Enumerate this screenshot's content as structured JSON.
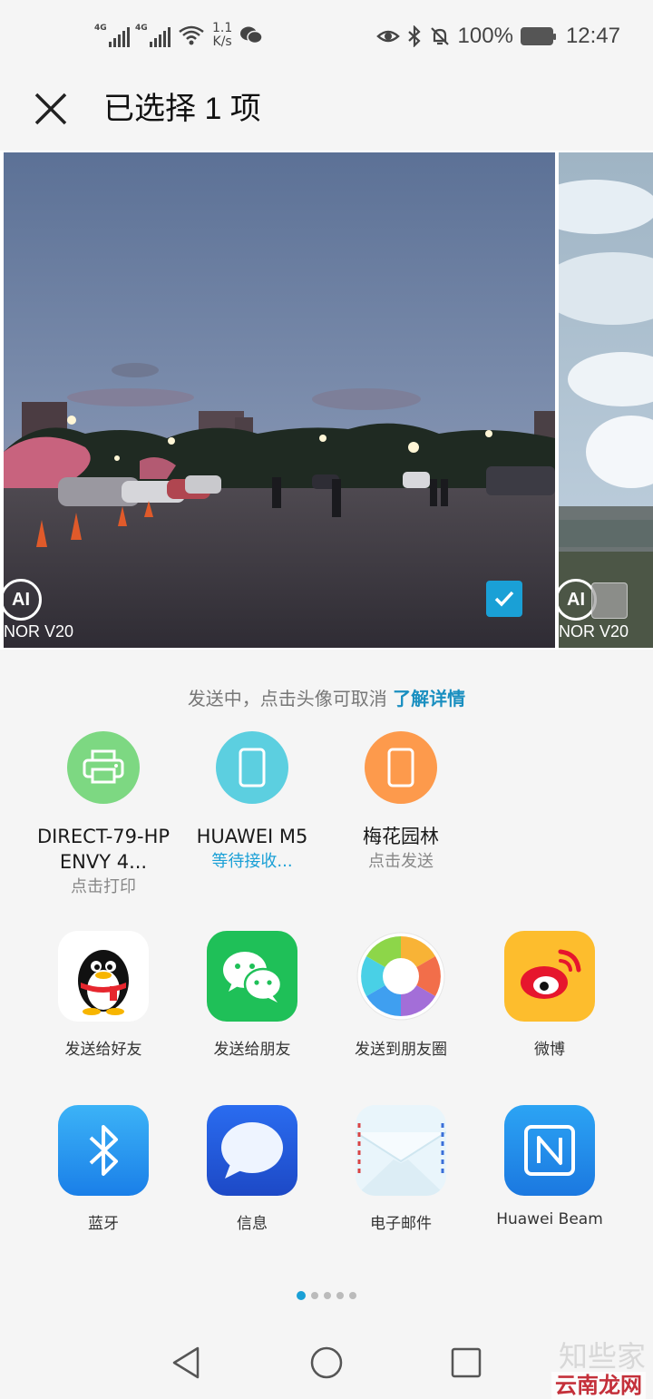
{
  "status_bar": {
    "net_label_1": "4G",
    "net_label_2": "4G",
    "speed_value": "1.1",
    "speed_unit": "K/s",
    "battery_percent": "100%",
    "time": "12:47"
  },
  "header": {
    "title": "已选择 1 项"
  },
  "photos": {
    "main": {
      "ai_label": "AI",
      "watermark": "NOR V20",
      "selected": true
    },
    "next": {
      "ai_label": "AI",
      "watermark": "NOR V20",
      "selected": false
    }
  },
  "share_hint": {
    "text": "发送中，点击头像可取消",
    "link": "了解详情"
  },
  "devices": [
    {
      "name": "DIRECT-79-HP ENVY 4...",
      "status": "点击打印",
      "color": "#7dd882",
      "icon": "printer-icon"
    },
    {
      "name": "HUAWEI M5",
      "status": "等待接收...",
      "color": "#5ccfe0",
      "icon": "tablet-icon"
    },
    {
      "name": "梅花园林",
      "status": "点击发送",
      "color": "#fd9a4c",
      "icon": "phone-icon"
    }
  ],
  "apps_row1": [
    {
      "label": "发送给好友",
      "icon": "qq-icon"
    },
    {
      "label": "发送给朋友",
      "icon": "wechat-icon"
    },
    {
      "label": "发送到朋友圈",
      "icon": "moments-icon"
    },
    {
      "label": "微博",
      "icon": "weibo-icon"
    }
  ],
  "apps_row2": [
    {
      "label": "蓝牙",
      "icon": "bluetooth-icon"
    },
    {
      "label": "信息",
      "icon": "message-icon"
    },
    {
      "label": "电子邮件",
      "icon": "email-icon"
    },
    {
      "label": "Huawei Beam",
      "icon": "nfc-icon"
    }
  ],
  "pager": {
    "pages": 5,
    "active": 1
  },
  "site_watermark": {
    "line1": "知些家",
    "line2": "云南龙网"
  },
  "colors": {
    "accent": "#1aa0d6",
    "background": "#f5f5f5"
  }
}
